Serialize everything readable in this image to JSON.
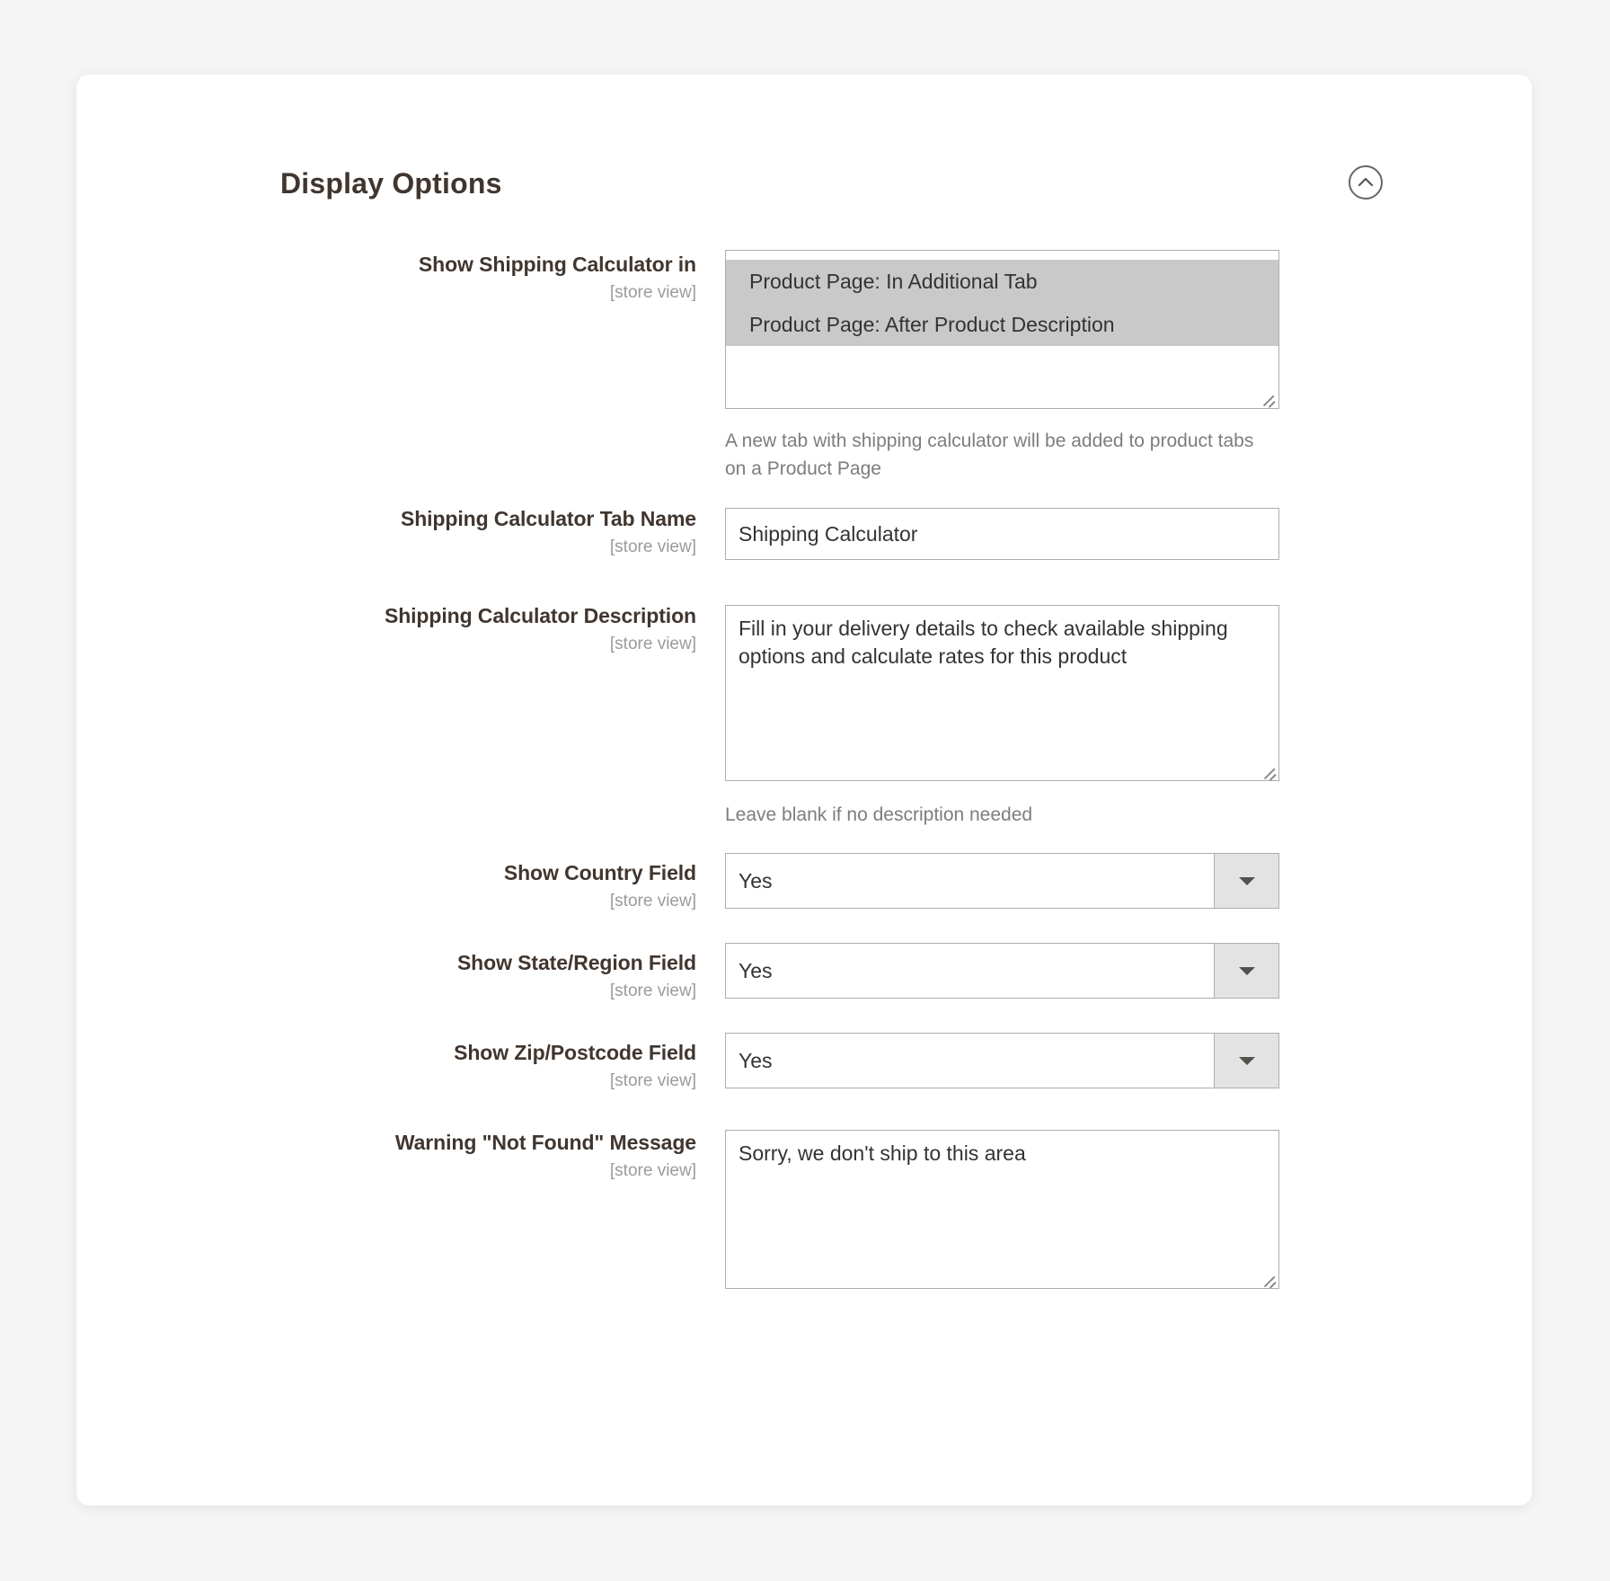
{
  "section": {
    "title": "Display Options",
    "collapse_icon": "chevron-up-circle-icon"
  },
  "fields": {
    "show_calculator_in": {
      "label": "Show Shipping Calculator in",
      "scope": "[store view]",
      "control": "multiselect",
      "options": [
        {
          "label": "Product Page: In Additional Tab",
          "selected": true
        },
        {
          "label": "Product Page: After Product Description",
          "selected": true
        }
      ],
      "note": "A new tab with shipping calculator will be added to product tabs on a Product Page"
    },
    "tab_name": {
      "label": "Shipping Calculator Tab Name",
      "scope": "[store view]",
      "control": "text",
      "value": "Shipping Calculator",
      "placeholder": ""
    },
    "description": {
      "label": "Shipping Calculator Description",
      "scope": "[store view]",
      "control": "textarea",
      "value": "Fill in your delivery details to check available shipping options and calculate rates for this product",
      "placeholder": "",
      "note": "Leave blank if no description needed"
    },
    "show_country": {
      "label": "Show Country Field",
      "scope": "[store view]",
      "control": "select",
      "value": "Yes"
    },
    "show_state": {
      "label": "Show State/Region Field",
      "scope": "[store view]",
      "control": "select",
      "value": "Yes"
    },
    "show_zip": {
      "label": "Show Zip/Postcode Field",
      "scope": "[store view]",
      "control": "select",
      "value": "Yes"
    },
    "warning_message": {
      "label": "Warning \"Not Found\" Message",
      "scope": "[store view]",
      "control": "textarea",
      "value": "Sorry, we don't ship to this area",
      "placeholder": ""
    }
  }
}
